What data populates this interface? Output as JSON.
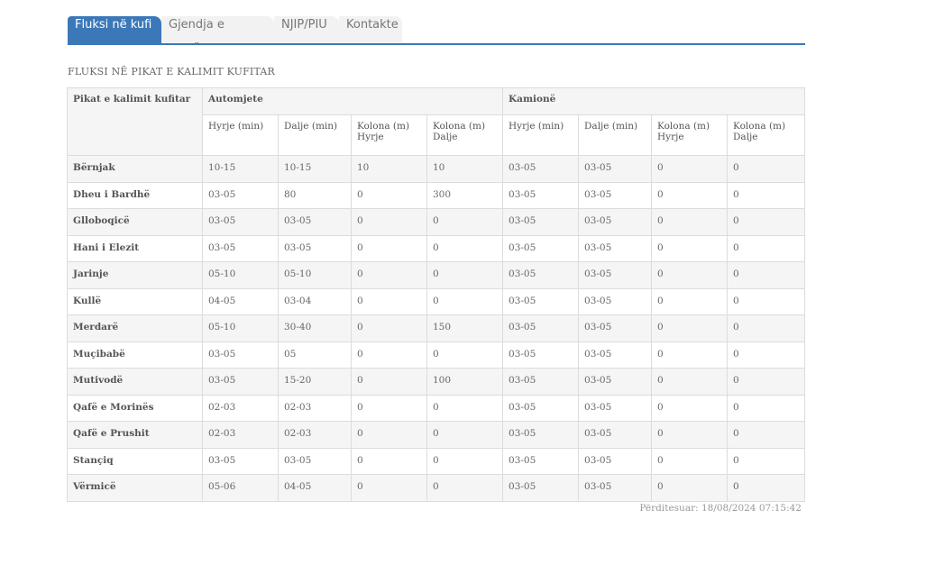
{
  "tabs": [
    {
      "label": "Fluksi në kufi",
      "active": true
    },
    {
      "label": "Gjendja e rrugëve",
      "active": false
    },
    {
      "label": "NJIP/PIU",
      "active": false
    },
    {
      "label": "Kontakte",
      "active": false
    }
  ],
  "section_title": "FLUKSI NË PIKAT E KALIMIT KUFITAR",
  "table": {
    "point_header": "Pikat e kalimit kufitar",
    "group_cars": "Automjete",
    "group_trucks": "Kamionë",
    "sub_headers": {
      "entry": "Hyrje (min)",
      "exit": "Dalje (min)",
      "queue_entry": "Kolona (m) Hyrje",
      "queue_exit": "Kolona (m) Dalje"
    },
    "rows": [
      {
        "name": "Bërnjak",
        "c_in": "10-15",
        "c_out": "10-15",
        "c_qin": "10",
        "c_qout": "10",
        "t_in": "03-05",
        "t_out": "03-05",
        "t_qin": "0",
        "t_qout": "0"
      },
      {
        "name": "Dheu i Bardhë",
        "c_in": "03-05",
        "c_out": "80",
        "c_qin": "0",
        "c_qout": "300",
        "t_in": "03-05",
        "t_out": "03-05",
        "t_qin": "0",
        "t_qout": "0"
      },
      {
        "name": "Glloboqicë",
        "c_in": "03-05",
        "c_out": "03-05",
        "c_qin": "0",
        "c_qout": "0",
        "t_in": "03-05",
        "t_out": "03-05",
        "t_qin": "0",
        "t_qout": "0"
      },
      {
        "name": "Hani i Elezit",
        "c_in": "03-05",
        "c_out": "03-05",
        "c_qin": "0",
        "c_qout": "0",
        "t_in": "03-05",
        "t_out": "03-05",
        "t_qin": "0",
        "t_qout": "0"
      },
      {
        "name": "Jarinje",
        "c_in": "05-10",
        "c_out": "05-10",
        "c_qin": "0",
        "c_qout": "0",
        "t_in": "03-05",
        "t_out": "03-05",
        "t_qin": "0",
        "t_qout": "0"
      },
      {
        "name": "Kullë",
        "c_in": "04-05",
        "c_out": "03-04",
        "c_qin": "0",
        "c_qout": "0",
        "t_in": "03-05",
        "t_out": "03-05",
        "t_qin": "0",
        "t_qout": "0"
      },
      {
        "name": "Merdarë",
        "c_in": "05-10",
        "c_out": "30-40",
        "c_qin": "0",
        "c_qout": "150",
        "t_in": "03-05",
        "t_out": "03-05",
        "t_qin": "0",
        "t_qout": "0"
      },
      {
        "name": "Muçibabë",
        "c_in": "03-05",
        "c_out": "05",
        "c_qin": "0",
        "c_qout": "0",
        "t_in": "03-05",
        "t_out": "03-05",
        "t_qin": "0",
        "t_qout": "0"
      },
      {
        "name": "Mutivodë",
        "c_in": "03-05",
        "c_out": "15-20",
        "c_qin": "0",
        "c_qout": "100",
        "t_in": "03-05",
        "t_out": "03-05",
        "t_qin": "0",
        "t_qout": "0"
      },
      {
        "name": "Qafë e Morinës",
        "c_in": "02-03",
        "c_out": "02-03",
        "c_qin": "0",
        "c_qout": "0",
        "t_in": "03-05",
        "t_out": "03-05",
        "t_qin": "0",
        "t_qout": "0"
      },
      {
        "name": "Qafë e Prushit",
        "c_in": "02-03",
        "c_out": "02-03",
        "c_qin": "0",
        "c_qout": "0",
        "t_in": "03-05",
        "t_out": "03-05",
        "t_qin": "0",
        "t_qout": "0"
      },
      {
        "name": "Stançiq",
        "c_in": "03-05",
        "c_out": "03-05",
        "c_qin": "0",
        "c_qout": "0",
        "t_in": "03-05",
        "t_out": "03-05",
        "t_qin": "0",
        "t_qout": "0"
      },
      {
        "name": "Vërmicë",
        "c_in": "05-06",
        "c_out": "04-05",
        "c_qin": "0",
        "c_qout": "0",
        "t_in": "03-05",
        "t_out": "03-05",
        "t_qin": "0",
        "t_qout": "0"
      }
    ]
  },
  "updated": "Përditesuar: 18/08/2024 07:15:42"
}
